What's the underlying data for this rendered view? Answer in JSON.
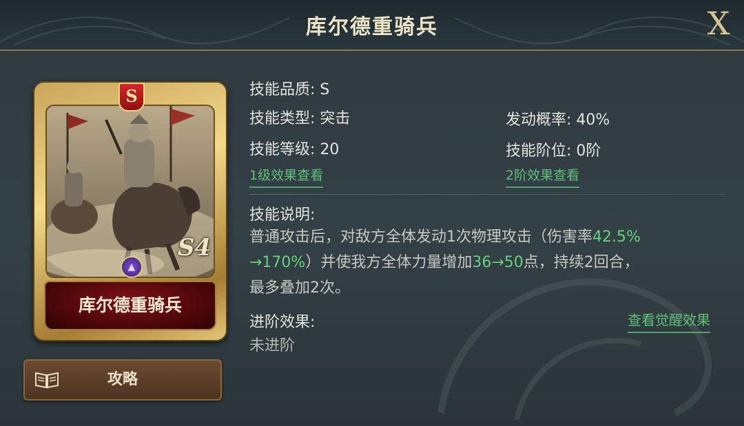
{
  "header": {
    "title": "库尔德重骑兵",
    "close_label": "X"
  },
  "card": {
    "rank_badge": "S",
    "level_mark": "S4",
    "name": "库尔德重骑兵",
    "emblem_icon": "triangle-emblem-icon"
  },
  "guide_button": {
    "label": "攻略",
    "icon": "book-icon"
  },
  "skill": {
    "quality": "技能品质: S",
    "type": "技能类型: 突击",
    "trigger": "发动概率: 40%",
    "level": "技能等级: 20",
    "tier": "技能阶位: 0阶",
    "link_level1": "1级效果查看",
    "link_tier2": "2阶效果查看"
  },
  "description": {
    "heading": "技能说明:",
    "seg1": "普通攻击后，对敌方全体发动1次物理攻击（伤害率",
    "hl1a": "42.5%",
    "hl1b": "→170%",
    "seg2": "）并使我方全体力量增加",
    "hl2": "36→50",
    "seg3": "点，持续2回合，",
    "seg4": "最多叠加2次。"
  },
  "advance": {
    "heading": "进阶效果:",
    "value": "未进阶",
    "awaken_link": "查看觉醒效果"
  },
  "colors": {
    "highlight": "#63d37d",
    "gold": "#d8c48d",
    "panel": "#334045"
  }
}
